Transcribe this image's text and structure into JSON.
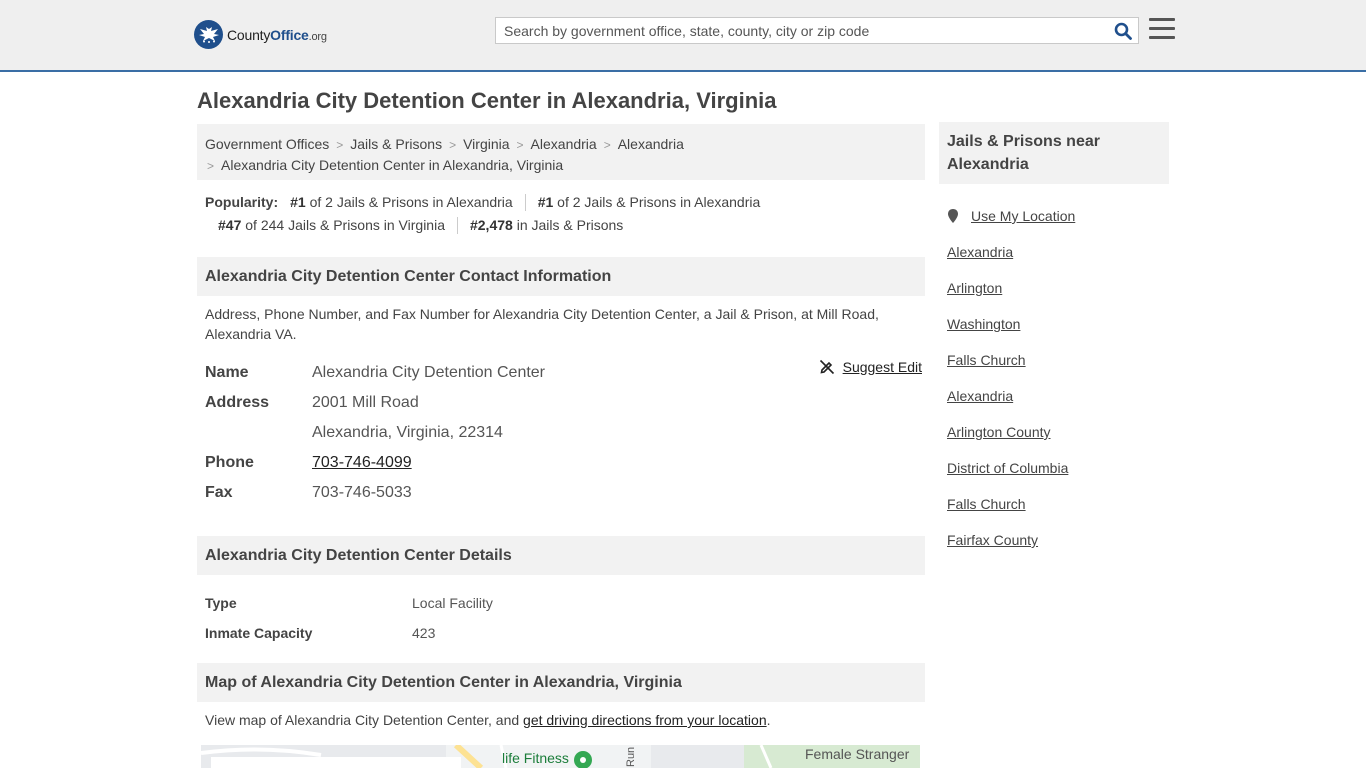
{
  "header": {
    "logo_county": "County",
    "logo_office": "Office",
    "logo_org": ".org",
    "search_placeholder": "Search by government office, state, county, city or zip code",
    "search_icon": "search-icon",
    "menu_icon": "hamburger-menu-icon"
  },
  "page": {
    "title": "Alexandria City Detention Center in Alexandria, Virginia"
  },
  "breadcrumb": {
    "items": [
      "Government Offices",
      "Jails & Prisons",
      "Virginia",
      "Alexandria",
      "Alexandria"
    ],
    "current": "Alexandria City Detention Center in Alexandria, Virginia"
  },
  "popularity": {
    "label": "Popularity:",
    "items": [
      {
        "rank": "#1",
        "text": "of 2 Jails & Prisons in Alexandria"
      },
      {
        "rank": "#1",
        "text": "of 2 Jails & Prisons in Alexandria"
      },
      {
        "rank": "#47",
        "text": "of 244 Jails & Prisons in Virginia"
      },
      {
        "rank": "#2,478",
        "text": "in Jails & Prisons"
      }
    ]
  },
  "contact": {
    "heading": "Alexandria City Detention Center Contact Information",
    "description": "Address, Phone Number, and Fax Number for Alexandria City Detention Center, a Jail & Prison, at Mill Road, Alexandria VA.",
    "suggest_edit": "Suggest Edit",
    "name_label": "Name",
    "name": "Alexandria City Detention Center",
    "address_label": "Address",
    "address_line1": "2001 Mill Road",
    "address_line2": "Alexandria, Virginia, 22314",
    "phone_label": "Phone",
    "phone": "703-746-4099",
    "fax_label": "Fax",
    "fax": "703-746-5033"
  },
  "details": {
    "heading": "Alexandria City Detention Center Details",
    "rows": [
      {
        "label": "Type",
        "value": "Local Facility"
      },
      {
        "label": "Inmate Capacity",
        "value": "423"
      }
    ]
  },
  "map": {
    "heading": "Map of Alexandria City Detention Center in Alexandria, Virginia",
    "description_prefix": "View map of Alexandria City Detention Center, and ",
    "directions_link": "get driving directions from your location",
    "description_suffix": ".",
    "label_fitness": "life Fitness",
    "label_run": "Run",
    "label_female": "Female Stranger"
  },
  "sidebar": {
    "heading": "Jails & Prisons near Alexandria",
    "use_location": "Use My Location",
    "links": [
      "Alexandria",
      "Arlington",
      "Washington",
      "Falls Church",
      "Alexandria",
      "Arlington County",
      "District of Columbia",
      "Falls Church",
      "Fairfax County"
    ]
  }
}
